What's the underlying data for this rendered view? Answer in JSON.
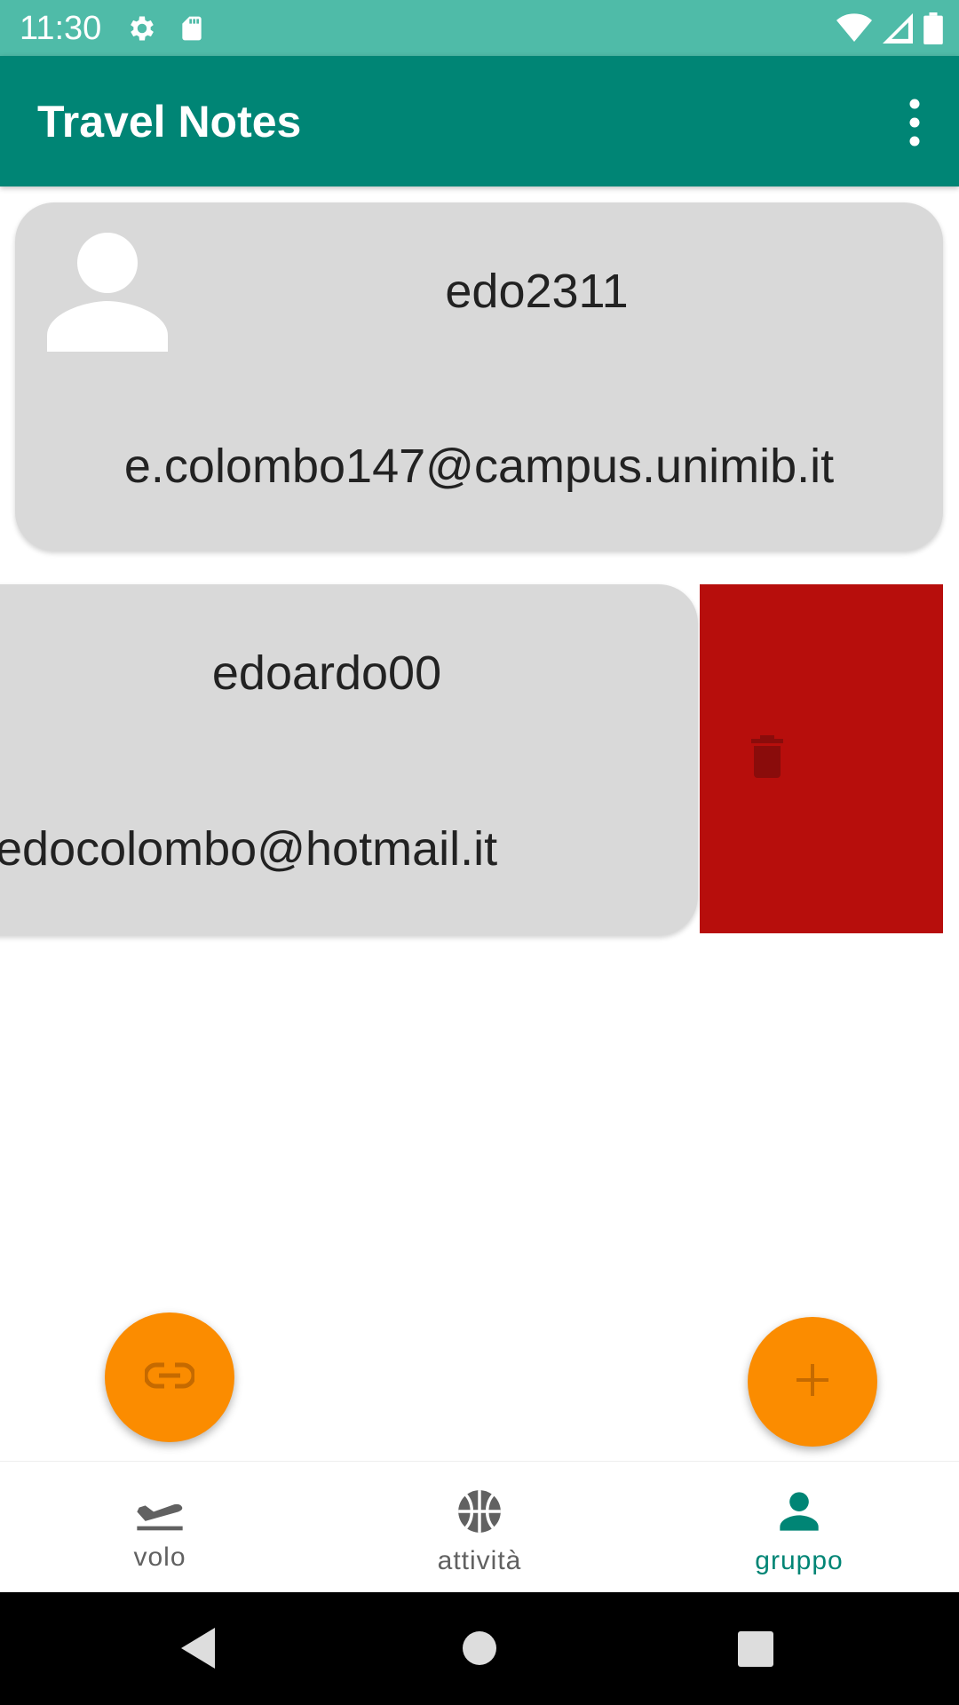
{
  "status_bar": {
    "time": "11:30",
    "icons": [
      "settings-icon",
      "sd-card-icon",
      "wifi-icon",
      "signal-icon",
      "battery-icon"
    ]
  },
  "app_bar": {
    "title": "Travel Notes",
    "menu_icon": "more-vert-icon"
  },
  "members": [
    {
      "username": "edo2311",
      "email": "e.colombo147@campus.unimib.it",
      "avatar": "person-icon"
    },
    {
      "username": "edoardo00",
      "email": "edocolombo@hotmail.it"
    }
  ],
  "swipe_action": {
    "icon": "trash-icon"
  },
  "fabs": {
    "link_icon": "link-icon",
    "add_icon": "plus-icon"
  },
  "bottom_nav": {
    "items": [
      {
        "label": "volo",
        "icon": "flight-takeoff-icon",
        "active": false
      },
      {
        "label": "attività",
        "icon": "basketball-icon",
        "active": false
      },
      {
        "label": "gruppo",
        "icon": "person-icon",
        "active": true
      }
    ]
  },
  "colors": {
    "status_bar": "#4fbba8",
    "app_bar": "#008575",
    "card": "#d9d9d9",
    "delete": "#b70e0c",
    "fab": "#fb8c00",
    "active": "#008575"
  }
}
